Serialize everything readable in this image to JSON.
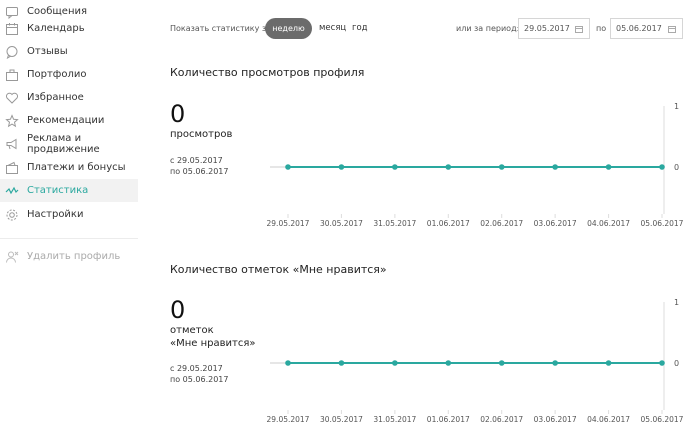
{
  "sidebar": {
    "items": [
      {
        "label": "Сообщения",
        "icon": "chat-icon",
        "top": 0
      },
      {
        "label": "Календарь",
        "icon": "calendar-icon",
        "top": 17
      },
      {
        "label": "Отзывы",
        "icon": "comment-icon",
        "top": 40
      },
      {
        "label": "Портфолио",
        "icon": "briefcase-icon",
        "top": 63
      },
      {
        "label": "Избранное",
        "icon": "heart-icon",
        "top": 86
      },
      {
        "label": "Рекомендации",
        "icon": "star-icon",
        "top": 109
      },
      {
        "label": "Реклама и продвижение",
        "icon": "megaphone-icon",
        "top": 132
      },
      {
        "label": "Платежи и бонусы",
        "icon": "wallet-icon",
        "top": 156
      },
      {
        "label": "Статистика",
        "icon": "stats-icon",
        "top": 179
      },
      {
        "label": "Настройки",
        "icon": "gear-icon",
        "top": 203
      },
      {
        "label": "Удалить профиль",
        "icon": "delete-user-icon",
        "top": 245
      }
    ]
  },
  "stats_bar": {
    "show_label": "Показать статистику за",
    "week": "неделю",
    "month": "месяц",
    "year": "год",
    "or_period": "или за период:",
    "date_from": "29.05.2017",
    "to_label": "по",
    "date_to": "05.06.2017"
  },
  "sections": [
    {
      "title": "Количество просмотров профиля",
      "value": "0",
      "label_line1": "просмотров",
      "label_line2": "",
      "range_from": "с 29.05.2017",
      "range_to": "по 05.06.2017"
    },
    {
      "title": "Количество отметок «Мне нравится»",
      "value": "0",
      "label_line1": "отметок",
      "label_line2": "«Мне нравится»",
      "range_from": "с 29.05.2017",
      "range_to": "по 05.06.2017"
    }
  ],
  "chart_data": [
    {
      "type": "line",
      "x": [
        "29.05.2017",
        "30.05.2017",
        "31.05.2017",
        "01.06.2017",
        "02.06.2017",
        "03.06.2017",
        "04.06.2017",
        "05.06.2017"
      ],
      "values": [
        0,
        0,
        0,
        0,
        0,
        0,
        0,
        0
      ],
      "ylim": [
        0,
        1
      ],
      "yticks": [
        "1",
        "0"
      ],
      "color": "#2aa89f",
      "grid": false
    },
    {
      "type": "line",
      "x": [
        "29.05.2017",
        "30.05.2017",
        "31.05.2017",
        "01.06.2017",
        "02.06.2017",
        "03.06.2017",
        "04.06.2017",
        "05.06.2017"
      ],
      "values": [
        0,
        0,
        0,
        0,
        0,
        0,
        0,
        0
      ],
      "ylim": [
        0,
        1
      ],
      "yticks": [
        "1",
        "0"
      ],
      "color": "#2aa89f",
      "grid": false
    }
  ]
}
